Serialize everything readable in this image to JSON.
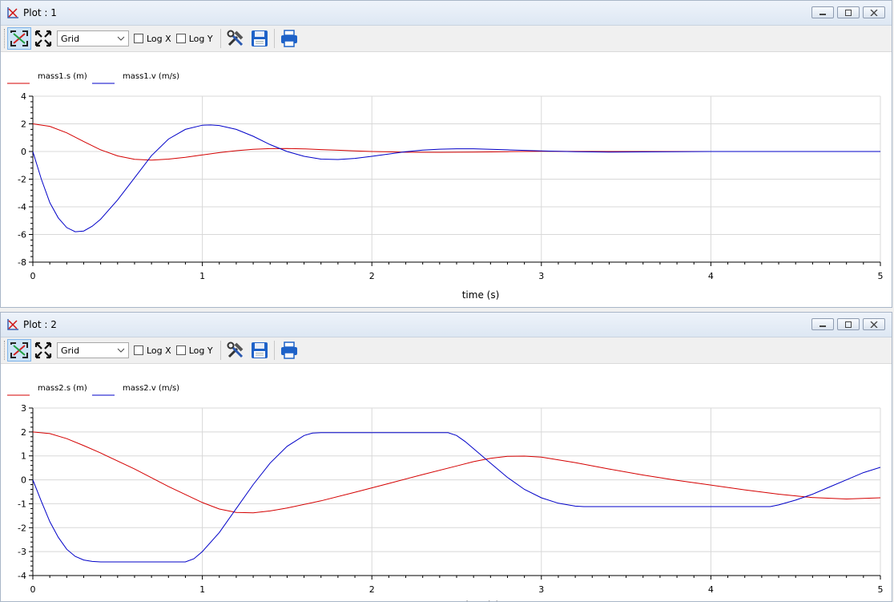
{
  "windows": [
    {
      "title": "Plot : 1",
      "grid_option": "Grid",
      "logx_label": "Log X",
      "logy_label": "Log Y",
      "chart_data": {
        "type": "line",
        "xlabel": "time (s)",
        "xlim": [
          0,
          5
        ],
        "ylim": [
          -8,
          4
        ],
        "xticks": [
          0,
          1,
          2,
          3,
          4,
          5
        ],
        "yticks": [
          -8,
          -6,
          -4,
          -2,
          0,
          2,
          4
        ],
        "grid": true,
        "legend_position": "top-left",
        "series": [
          {
            "name": "mass1.s (m)",
            "color": "#d40000",
            "x": [
              0,
              0.1,
              0.2,
              0.3,
              0.4,
              0.5,
              0.6,
              0.7,
              0.8,
              0.9,
              1.0,
              1.1,
              1.2,
              1.3,
              1.4,
              1.5,
              1.6,
              1.7,
              1.8,
              1.9,
              2.0,
              2.2,
              2.4,
              2.6,
              2.8,
              3.0,
              3.4,
              3.8,
              4.3,
              4.31,
              5.0
            ],
            "y": [
              2.0,
              1.82,
              1.35,
              0.72,
              0.12,
              -0.32,
              -0.56,
              -0.62,
              -0.55,
              -0.42,
              -0.25,
              -0.08,
              0.06,
              0.16,
              0.21,
              0.22,
              0.19,
              0.14,
              0.09,
              0.04,
              0.0,
              -0.05,
              -0.06,
              -0.04,
              -0.01,
              0.01,
              0.0,
              0.0,
              0.0,
              0.0,
              0.0
            ]
          },
          {
            "name": "mass1.v (m/s)",
            "color": "#0000c8",
            "x": [
              0,
              0.05,
              0.1,
              0.15,
              0.2,
              0.25,
              0.3,
              0.35,
              0.4,
              0.5,
              0.6,
              0.7,
              0.8,
              0.9,
              1.0,
              1.05,
              1.1,
              1.2,
              1.3,
              1.4,
              1.5,
              1.6,
              1.7,
              1.8,
              1.9,
              2.0,
              2.1,
              2.2,
              2.3,
              2.4,
              2.5,
              2.6,
              2.8,
              3.0,
              3.2,
              3.4,
              3.6,
              4.0,
              4.5,
              5.0
            ],
            "y": [
              0.0,
              -2.0,
              -3.7,
              -4.8,
              -5.5,
              -5.8,
              -5.75,
              -5.4,
              -4.9,
              -3.5,
              -1.9,
              -0.3,
              0.9,
              1.6,
              1.9,
              1.92,
              1.88,
              1.6,
              1.1,
              0.5,
              0.0,
              -0.35,
              -0.55,
              -0.58,
              -0.5,
              -0.35,
              -0.18,
              -0.02,
              0.1,
              0.17,
              0.2,
              0.2,
              0.12,
              0.04,
              -0.02,
              -0.04,
              -0.03,
              0.0,
              0.0,
              0.0
            ]
          }
        ]
      }
    },
    {
      "title": "Plot : 2",
      "grid_option": "Grid",
      "logx_label": "Log X",
      "logy_label": "Log Y",
      "chart_data": {
        "type": "line",
        "xlabel": "time (s)",
        "xlim": [
          0,
          5
        ],
        "ylim": [
          -4,
          3
        ],
        "xticks": [
          0,
          1,
          2,
          3,
          4,
          5
        ],
        "yticks": [
          -4,
          -3,
          -2,
          -1,
          0,
          1,
          2,
          3
        ],
        "grid": true,
        "legend_position": "top-left",
        "series": [
          {
            "name": "mass2.s (m)",
            "color": "#d40000",
            "x": [
              0,
              0.1,
              0.2,
              0.3,
              0.4,
              0.6,
              0.8,
              1.0,
              1.1,
              1.2,
              1.3,
              1.4,
              1.5,
              1.7,
              1.9,
              2.1,
              2.3,
              2.5,
              2.6,
              2.7,
              2.8,
              2.9,
              3.0,
              3.2,
              3.4,
              3.6,
              3.8,
              4.0,
              4.2,
              4.4,
              4.6,
              4.8,
              5.0
            ],
            "y": [
              2.0,
              1.93,
              1.72,
              1.43,
              1.12,
              0.45,
              -0.28,
              -0.95,
              -1.22,
              -1.36,
              -1.38,
              -1.3,
              -1.18,
              -0.88,
              -0.52,
              -0.15,
              0.22,
              0.58,
              0.76,
              0.9,
              0.98,
              0.99,
              0.95,
              0.72,
              0.45,
              0.2,
              -0.02,
              -0.22,
              -0.42,
              -0.6,
              -0.74,
              -0.8,
              -0.75
            ]
          },
          {
            "name": "mass2.v (m/s)",
            "color": "#0000c8",
            "x": [
              0,
              0.05,
              0.1,
              0.15,
              0.2,
              0.25,
              0.3,
              0.35,
              0.4,
              0.45,
              0.9,
              0.95,
              1.0,
              1.1,
              1.2,
              1.3,
              1.4,
              1.5,
              1.6,
              1.65,
              1.7,
              2.45,
              2.5,
              2.55,
              2.6,
              2.7,
              2.8,
              2.9,
              3.0,
              3.1,
              3.2,
              3.25,
              4.35,
              4.4,
              4.5,
              4.6,
              4.7,
              4.8,
              4.9,
              5.0
            ],
            "y": [
              0.0,
              -0.9,
              -1.75,
              -2.4,
              -2.9,
              -3.2,
              -3.35,
              -3.41,
              -3.43,
              -3.43,
              -3.43,
              -3.3,
              -3.0,
              -2.2,
              -1.2,
              -0.2,
              0.7,
              1.4,
              1.85,
              1.95,
              1.97,
              1.97,
              1.85,
              1.6,
              1.3,
              0.7,
              0.1,
              -0.4,
              -0.75,
              -0.98,
              -1.1,
              -1.12,
              -1.12,
              -1.05,
              -0.85,
              -0.6,
              -0.3,
              0.0,
              0.3,
              0.52
            ]
          }
        ]
      }
    }
  ]
}
